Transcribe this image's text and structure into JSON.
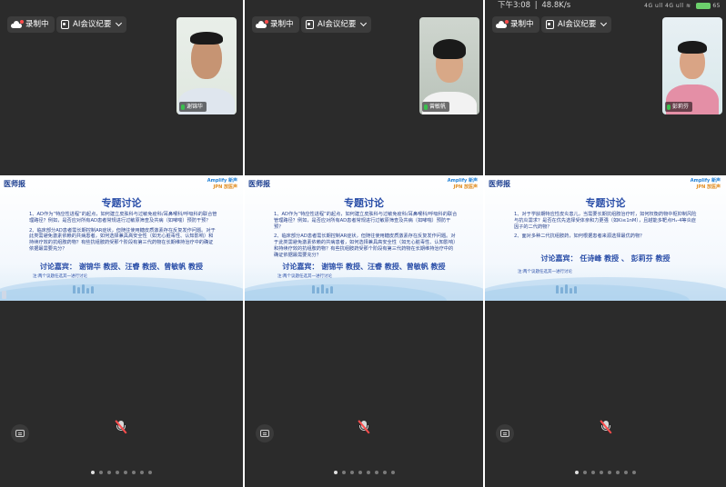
{
  "status_bar": {
    "time": "下午3:08",
    "speed": "48.8K/s",
    "signal": "4G ull 4G ull ≋",
    "battery": "65"
  },
  "toolbar": {
    "record_label": "录制中",
    "ai_label": "AI会议纪要"
  },
  "panels": [
    {
      "participant_name": "谢锦华",
      "slide": {
        "logo": "医师报",
        "brand_line1": "Amplify 新声",
        "brand_line2": "JPN 放医声",
        "title": "专题讨论",
        "points": [
          "1、AD作为“特应性进程”的起点，如何建立皮肤科与过敏免疫科/耳鼻喉科/呼吸科的联合管理路径？例如，是否应对所有AD患者常规进行过敏原筛查及共病（如哮喘）预防干预？",
          "2、临床部分AD患者需长期控制AR症状，但随往使用糖皮质激素存在反复发作问题。对于此类需避免激素依赖的共病患者，如何选择兼具高安全性（如无心脏毒性、认知影响）和持续疗效的抗组胺药物？有些抗组胺药受那个阶段有第三代药物在长期维持治疗中的确证依据最需要充分？"
        ],
        "guests": "讨论嘉宾： 谢锦华 教授、汪睿 教授、曾敏帆 教授",
        "note": "注:两个议题任选其一进行讨论"
      },
      "active_page": 0
    },
    {
      "participant_name": "曾敏帆",
      "slide": {
        "logo": "医师报",
        "brand_line1": "Amplify 新声",
        "brand_line2": "JPN 放医声",
        "title": "专题讨论",
        "points": [
          "1、AD作为“特应性进程”的起点，如何建立皮肤科与过敏免疫科/耳鼻喉科/呼吸科的联合管理路径？例如，是否应对所有AD患者常规进行过敏原筛查及共病（如哮喘）预防干预？",
          "2、临床部分AD患者需长期控制AR症状，但随往使用糖皮质激素存在反复发作问题。对于此类需避免激素依赖的共病患者，如何选择兼具高安全性（如无心脏毒性、认知影响）和持续疗效的抗组胺药物？有些抗组胺药受那个阶段有第三代药物在长期维持治疗中的确证依据最需要充分？"
        ],
        "guests": "讨论嘉宾： 谢锦华 教授、汪睿 教授、曾敏帆 教授",
        "note": "注:两个议题任选其一进行讨论"
      },
      "active_page": 0
    },
    {
      "participant_name": "彭莉芬",
      "slide": {
        "logo": "医师报",
        "brand_line1": "Amplify 新声",
        "brand_line2": "JPN 放医声",
        "title": "专题讨论",
        "points": [
          "1、对于学龄期特应性皮炎患儿，当需要长期抗组胺治疗时，如何权衡药物中枢抑制风险与抗炎需求？是否在优先选择受体亲和力更强（如Ki≤1nM），且越能多靶点H₁-4等炎症因子的二代药物？",
          "2、面对多种二代抗组胺药，如何根据患者来源选择最优药物？"
        ],
        "guests": "讨论嘉宾： 任诗峰 教授 、 彭莉芬 教授",
        "note": "注:两个议题任选其一进行讨论"
      },
      "active_page": 0
    }
  ],
  "pager": {
    "count": 8
  },
  "colors": {
    "panel_bg": "#2b2b2b",
    "slide_title": "#2a4ea8",
    "mic_muted": "#ff4d4d",
    "mic_active": "#39c04d"
  },
  "icons": [
    "cloud-record-icon",
    "document-icon",
    "chevron-down-icon",
    "microphone-icon",
    "muted-microphone-icon",
    "chat-icon"
  ]
}
